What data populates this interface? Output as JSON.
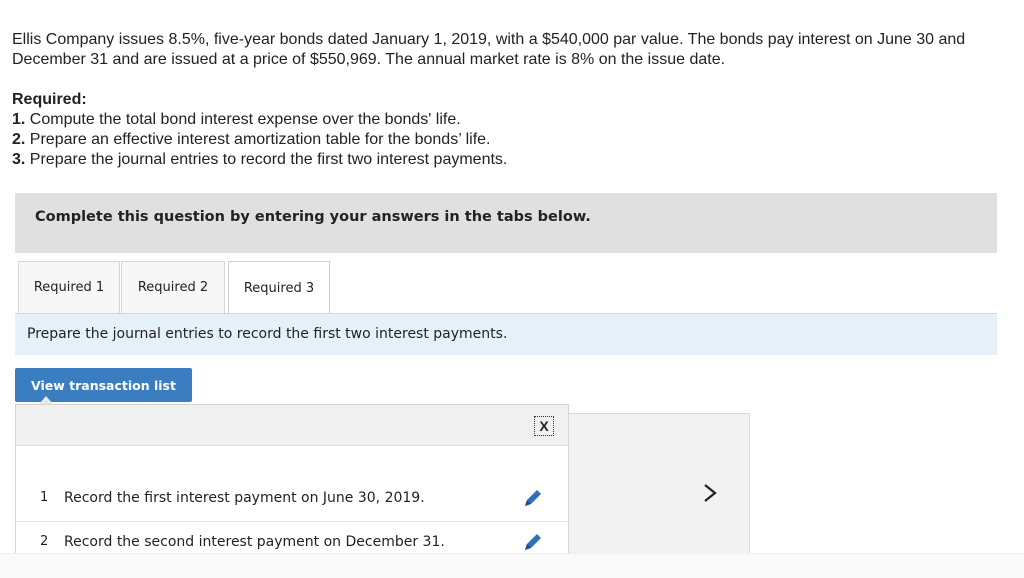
{
  "problem": {
    "text": "Ellis Company issues 8.5%, five-year bonds dated January 1, 2019, with a $540,000 par value. The bonds pay interest on June 30 and December 31 and are issued at a price of $550,969. The annual market rate is 8% on the issue date."
  },
  "required": {
    "heading": "Required:",
    "items": [
      {
        "num": "1.",
        "text": " Compute the total bond interest expense over the bonds' life."
      },
      {
        "num": "2.",
        "text": " Prepare an effective interest amortization table for the bonds’ life."
      },
      {
        "num": "3.",
        "text": " Prepare the journal entries to record the first two interest payments."
      }
    ]
  },
  "banner": {
    "text": "Complete this question by entering your answers in the tabs below."
  },
  "tabs": [
    {
      "label": "Required 1"
    },
    {
      "label": "Required 2"
    },
    {
      "label": "Required 3"
    }
  ],
  "instructions": {
    "text": "Prepare the journal entries to record the first two interest payments."
  },
  "view_transaction_list": {
    "label": "View transaction list"
  },
  "transactions": [
    {
      "num": "1",
      "text": "Record the first interest payment on June 30, 2019."
    },
    {
      "num": "2",
      "text": "Record the second interest payment on December 31."
    }
  ],
  "close_symbol": "X",
  "colors": {
    "accent": "#3a7ec1",
    "edit_icon": "#2f6fb6"
  }
}
